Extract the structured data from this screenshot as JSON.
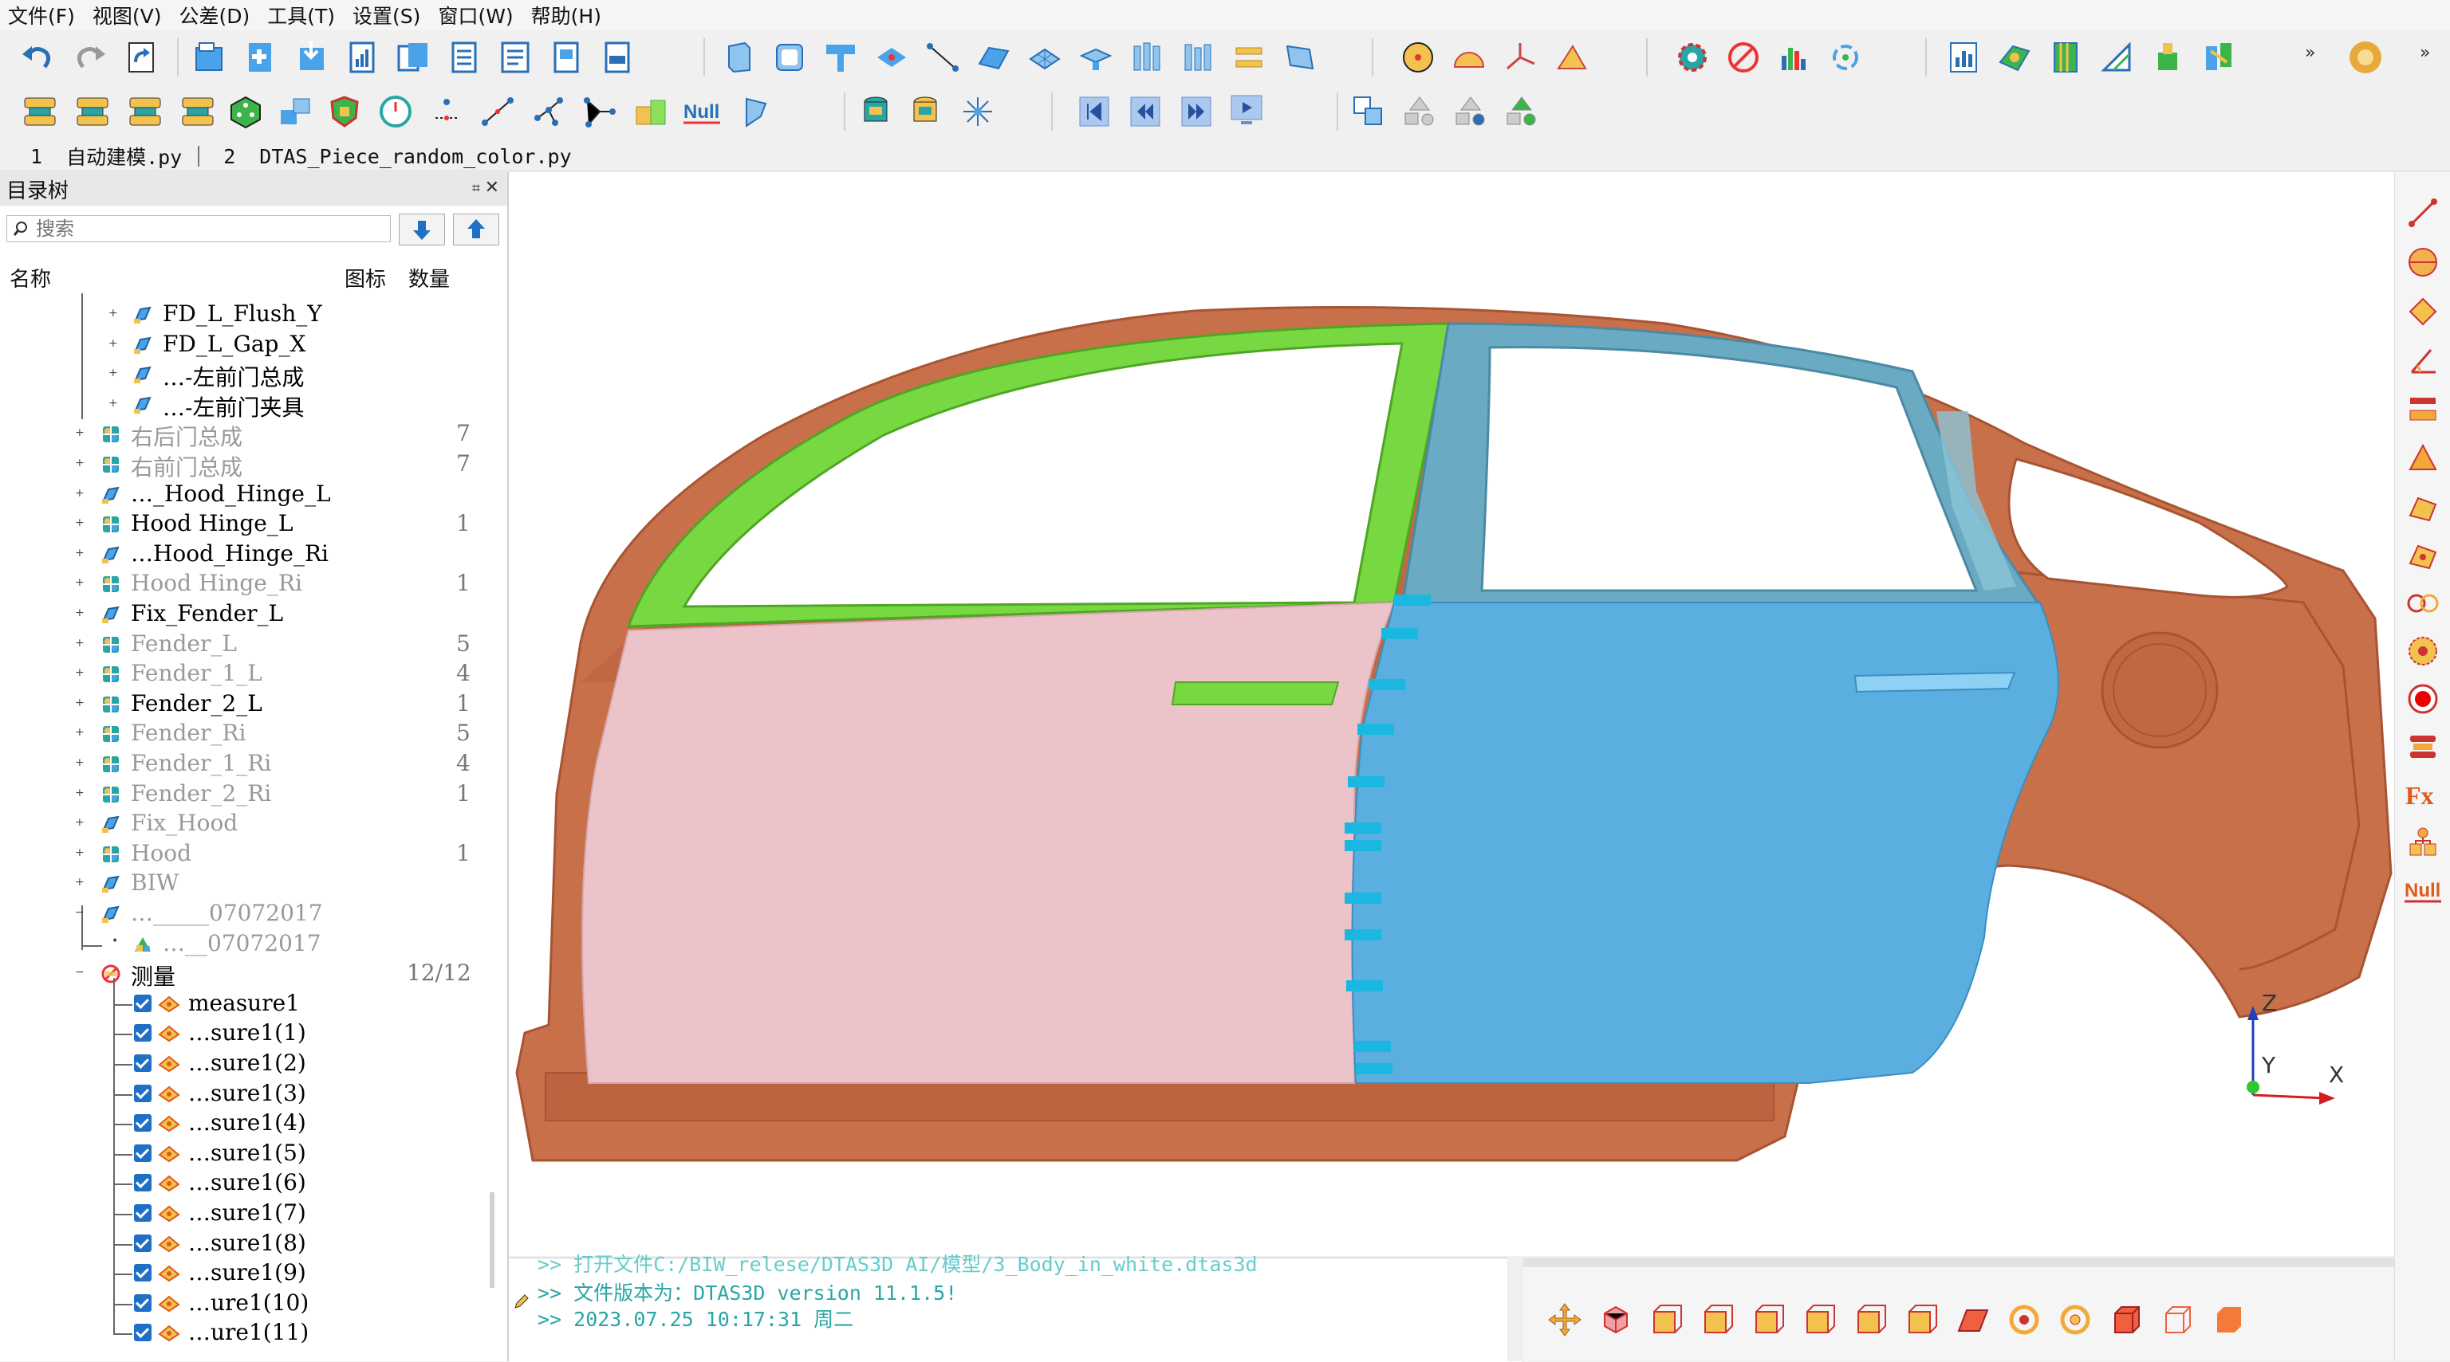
{
  "menu": [
    "文件(F)",
    "视图(V)",
    "公差(D)",
    "工具(T)",
    "设置(S)",
    "窗口(W)",
    "帮助(H)"
  ],
  "toolbar1": {
    "icons": [
      "undo-icon",
      "redo-icon",
      "refresh-icon",
      "open-file-icon",
      "new-file-icon",
      "import-file-icon",
      "report-icon",
      "doc-export-icon",
      "doc-icon",
      "doc-list-icon",
      "page-icon",
      "word-ppt-icon",
      "cube-icon",
      "cylinder-icon",
      "hammer-icon",
      "plane-icon",
      "line-points-icon",
      "surface-mesh-icon",
      "grid-surface-icon",
      "stamp-icon",
      "fixture-icon",
      "fixture2-icon",
      "planes-icon",
      "sheet-icon",
      "compass-icon",
      "protractor-icon",
      "axis-icon",
      "angle-icon",
      "gear-settings-icon",
      "no-measure-icon",
      "bar-chart-icon",
      "cycle-icon",
      "statistics-chart-icon",
      "contour-icon",
      "book-icon",
      "triangle-ruler-icon",
      "assembly-icon",
      "frame-icon",
      "ring-icon"
    ],
    "more": "»"
  },
  "toolbar2": {
    "icons": [
      "clamp1-icon",
      "clamp2-icon",
      "clamp3-icon",
      "clamp4-icon",
      "dice-icon",
      "blocks-icon",
      "shield-icon",
      "gauge-icon",
      "point-icon",
      "line-icon",
      "network-icon",
      "path-icon",
      "cubes-icon",
      "null-icon",
      "plane-flag-icon",
      "stack1-icon",
      "stack2-icon",
      "sparkle-icon",
      "first-icon",
      "rewind-icon",
      "forward-icon",
      "play-icon",
      "copy-shapes-icon",
      "shapes1-icon",
      "shapes2-icon",
      "shapes3-icon"
    ],
    "null_label": "Null"
  },
  "tabs": [
    {
      "num": "1",
      "label": "自动建模.py"
    },
    {
      "num": "2",
      "label": "DTAS_Piece_random_color.py"
    }
  ],
  "panel": {
    "title": "目录树",
    "search_placeholder": "搜索",
    "col_name": "名称",
    "col_icon": "图标",
    "col_count": "数量"
  },
  "tree": [
    {
      "label": "FD_L_Flush_Y",
      "icon": "feature-icon",
      "dim": false,
      "count": "",
      "level": 2
    },
    {
      "label": "FD_L_Gap_X",
      "icon": "feature-icon",
      "dim": false,
      "count": "",
      "level": 2
    },
    {
      "label": "…-左前门总成",
      "icon": "feature-icon",
      "dim": false,
      "count": "",
      "level": 2
    },
    {
      "label": "…-左前门夹具",
      "icon": "feature-icon",
      "dim": false,
      "count": "",
      "level": 2
    },
    {
      "label": "右后门总成",
      "icon": "assembly-icon",
      "dim": true,
      "count": "7",
      "level": 1
    },
    {
      "label": "右前门总成",
      "icon": "assembly-icon",
      "dim": true,
      "count": "7",
      "level": 1
    },
    {
      "label": "…_Hood_Hinge_L",
      "icon": "feature-icon",
      "dim": false,
      "count": "",
      "level": 1
    },
    {
      "label": "Hood Hinge_L",
      "icon": "assembly-icon",
      "dim": false,
      "count": "1",
      "level": 1
    },
    {
      "label": "…Hood_Hinge_Ri",
      "icon": "feature-icon",
      "dim": false,
      "count": "",
      "level": 1
    },
    {
      "label": "Hood Hinge_Ri",
      "icon": "assembly-icon",
      "dim": true,
      "count": "1",
      "level": 1
    },
    {
      "label": "Fix_Fender_L",
      "icon": "feature-icon",
      "dim": false,
      "count": "",
      "level": 1
    },
    {
      "label": "Fender_L",
      "icon": "assembly-icon",
      "dim": true,
      "count": "5",
      "level": 1
    },
    {
      "label": "Fender_1_L",
      "icon": "assembly-icon",
      "dim": true,
      "count": "4",
      "level": 1
    },
    {
      "label": "Fender_2_L",
      "icon": "assembly-icon",
      "dim": false,
      "count": "1",
      "level": 1
    },
    {
      "label": "Fender_Ri",
      "icon": "assembly-icon",
      "dim": true,
      "count": "5",
      "level": 1
    },
    {
      "label": "Fender_1_Ri",
      "icon": "assembly-icon",
      "dim": true,
      "count": "4",
      "level": 1
    },
    {
      "label": "Fender_2_Ri",
      "icon": "assembly-icon",
      "dim": true,
      "count": "1",
      "level": 1
    },
    {
      "label": "Fix_Hood",
      "icon": "feature-icon",
      "dim": true,
      "count": "",
      "level": 1
    },
    {
      "label": "Hood",
      "icon": "assembly-icon",
      "dim": true,
      "count": "1",
      "level": 1
    },
    {
      "label": "BIW",
      "icon": "feature-icon",
      "dim": true,
      "count": "",
      "level": 1
    },
    {
      "label": "…_____07072017",
      "icon": "feature-icon",
      "dim": true,
      "count": "",
      "level": 1
    },
    {
      "label": "…__07072017",
      "icon": "part-icon",
      "dim": true,
      "count": "",
      "level": 2
    },
    {
      "label": "测量",
      "icon": "measure-folder-icon",
      "dim": false,
      "count": "12/12",
      "level": 1
    }
  ],
  "measures": [
    "measure1",
    "…sure1(1)",
    "…sure1(2)",
    "…sure1(3)",
    "…sure1(4)",
    "…sure1(5)",
    "…sure1(6)",
    "…sure1(7)",
    "…sure1(8)",
    "…sure1(9)",
    "…ure1(10)",
    "…ure1(11)"
  ],
  "console": [
    ">>  打开文件C:/BIW_relese/DTAS3D  AI/模型/3_Body_in_white.dtas3d",
    ">>  文件版本为：DTAS3D  version  11.1.5!",
    ">>  2023.07.25  10:17:31  周二"
  ],
  "axis": {
    "x": "X",
    "y": "Y",
    "z": "Z"
  },
  "colors": {
    "body": "#c8704a",
    "front_door": "#ebc3c8",
    "rear_door": "#5aaee0",
    "glass_frame": "#78d842",
    "rear_frame": "#6aaac2",
    "accent": "#1f6fc5"
  },
  "right_toolbar": [
    "measure-line-icon",
    "sphere-icon",
    "diamond-icon",
    "angle-measure-icon",
    "flatness-icon",
    "cone-icon",
    "profile-icon",
    "profile2-icon",
    "concentric-icon",
    "target-icon",
    "record-icon",
    "stack-icon",
    "fx-icon",
    "hierarchy-icon",
    "null-icon"
  ],
  "fx_label": "Fx",
  "bottom_toolbar": [
    "move-icon",
    "cube-red-icon",
    "box1-icon",
    "box2-icon",
    "box3-icon",
    "box4-icon",
    "box5-icon",
    "box6-icon",
    "plane-red-icon",
    "rotate1-icon",
    "rotate2-icon",
    "solid-cube-icon",
    "wire-cube-icon",
    "orange-cube-icon"
  ]
}
